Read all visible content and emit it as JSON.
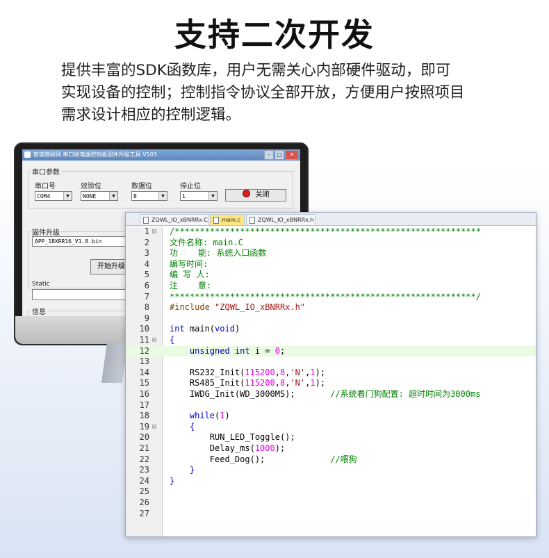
{
  "headline": "支持二次开发",
  "description_lines": [
    "提供丰富的SDK函数库，用户无需关心内部硬件驱动，即可",
    "实现设备的控制；控制指令协议全部开放，方便用户按照项目",
    "需求设计相应的控制逻辑。"
  ],
  "app": {
    "title": "智嵌物联网 串口继电器控制板固件升级工具 V103",
    "window_buttons": [
      "–",
      "□",
      "✕"
    ],
    "serial_group": "串口参数",
    "port_label": "串口号",
    "port_value": "COM4",
    "parity_label": "效验位",
    "parity_value": "NONE",
    "databits_label": "数据位",
    "databits_value": "8",
    "stopbits_label": "停止位",
    "stopbits_value": "1",
    "close_button": "关闭",
    "firmware_group": "固件升级",
    "firmware_file": "APP_1BXRR16_V1.8.bin",
    "upgrade_button": "开始升级",
    "static_label": "Static",
    "info_group": "信息"
  },
  "editor": {
    "tabs": [
      "ZQWL_IO_xBNRRx.C",
      "main.c",
      "ZQWL_IO_xBNRRx.h"
    ],
    "active_tab": 1,
    "highlight_line": 12,
    "lines": [
      {
        "n": "1",
        "fold": "⊟",
        "parts": [
          [
            "c-com",
            "/*************************************************************"
          ]
        ]
      },
      {
        "n": "2",
        "fold": "",
        "parts": [
          [
            "c-com",
            "文件名称: main.C"
          ]
        ]
      },
      {
        "n": "3",
        "fold": "",
        "parts": [
          [
            "c-com",
            "功    能: 系统入口函数"
          ]
        ]
      },
      {
        "n": "4",
        "fold": "",
        "parts": [
          [
            "c-com",
            "编写时间:"
          ]
        ]
      },
      {
        "n": "5",
        "fold": "",
        "parts": [
          [
            "c-com",
            "编 写 人:"
          ]
        ]
      },
      {
        "n": "6",
        "fold": "",
        "parts": [
          [
            "c-com",
            "注    意:"
          ]
        ]
      },
      {
        "n": "7",
        "fold": "",
        "parts": [
          [
            "c-com",
            "*************************************************************/"
          ]
        ]
      },
      {
        "n": "8",
        "fold": "",
        "parts": [
          [
            "c-pp",
            "#include "
          ],
          [
            "c-str",
            "\"ZQWL_IO_xBNRRx.h\""
          ]
        ]
      },
      {
        "n": "9",
        "fold": "",
        "parts": []
      },
      {
        "n": "10",
        "fold": "",
        "parts": [
          [
            "c-kw",
            "int"
          ],
          [
            "c-fn",
            " main("
          ],
          [
            "c-kw",
            "void"
          ],
          [
            "c-fn",
            ")"
          ]
        ]
      },
      {
        "n": "11",
        "fold": "⊟",
        "parts": [
          [
            "c-kw",
            "{"
          ]
        ]
      },
      {
        "n": "12",
        "fold": "",
        "parts": [
          [
            "c-fn",
            "    "
          ],
          [
            "c-kw",
            "unsigned int"
          ],
          [
            "c-fn",
            " i = "
          ],
          [
            "c-num",
            "0"
          ],
          [
            "c-fn",
            ";"
          ]
        ]
      },
      {
        "n": "13",
        "fold": "",
        "parts": []
      },
      {
        "n": "14",
        "fold": "",
        "parts": [
          [
            "c-fn",
            "    RS232_Init("
          ],
          [
            "c-num",
            "115200"
          ],
          [
            "c-fn",
            ","
          ],
          [
            "c-num",
            "8"
          ],
          [
            "c-fn",
            ","
          ],
          [
            "c-str",
            "'N'"
          ],
          [
            "c-fn",
            ","
          ],
          [
            "c-num",
            "1"
          ],
          [
            "c-fn",
            ");"
          ]
        ]
      },
      {
        "n": "15",
        "fold": "",
        "parts": [
          [
            "c-fn",
            "    RS485_Init("
          ],
          [
            "c-num",
            "115200"
          ],
          [
            "c-fn",
            ","
          ],
          [
            "c-num",
            "8"
          ],
          [
            "c-fn",
            ","
          ],
          [
            "c-str",
            "'N'"
          ],
          [
            "c-fn",
            ","
          ],
          [
            "c-num",
            "1"
          ],
          [
            "c-fn",
            ");"
          ]
        ]
      },
      {
        "n": "16",
        "fold": "",
        "parts": [
          [
            "c-fn",
            "    IWDG_Init(WD_3000MS);       "
          ],
          [
            "c-com",
            "//系统看门狗配置: 超时时间为3000ms"
          ]
        ]
      },
      {
        "n": "17",
        "fold": "",
        "parts": []
      },
      {
        "n": "18",
        "fold": "",
        "parts": [
          [
            "c-fn",
            "    "
          ],
          [
            "c-kw",
            "while"
          ],
          [
            "c-fn",
            "("
          ],
          [
            "c-num",
            "1"
          ],
          [
            "c-fn",
            ")"
          ]
        ]
      },
      {
        "n": "19",
        "fold": "⊟",
        "parts": [
          [
            "c-fn",
            "    "
          ],
          [
            "c-kw",
            "{"
          ]
        ]
      },
      {
        "n": "20",
        "fold": "",
        "parts": [
          [
            "c-fn",
            "        RUN_LED_Toggle();"
          ]
        ]
      },
      {
        "n": "21",
        "fold": "",
        "parts": [
          [
            "c-fn",
            "        Delay_ms("
          ],
          [
            "c-num",
            "1000"
          ],
          [
            "c-fn",
            ");"
          ]
        ]
      },
      {
        "n": "22",
        "fold": "",
        "parts": [
          [
            "c-fn",
            "        Feed_Dog();             "
          ],
          [
            "c-com",
            "//喂狗"
          ]
        ]
      },
      {
        "n": "23",
        "fold": "",
        "parts": [
          [
            "c-fn",
            "    "
          ],
          [
            "c-kw",
            "}"
          ]
        ]
      },
      {
        "n": "24",
        "fold": "",
        "parts": [
          [
            "c-kw",
            "}"
          ]
        ]
      },
      {
        "n": "25",
        "fold": "",
        "parts": []
      },
      {
        "n": "26",
        "fold": "",
        "parts": []
      },
      {
        "n": "27",
        "fold": "",
        "parts": []
      }
    ]
  }
}
